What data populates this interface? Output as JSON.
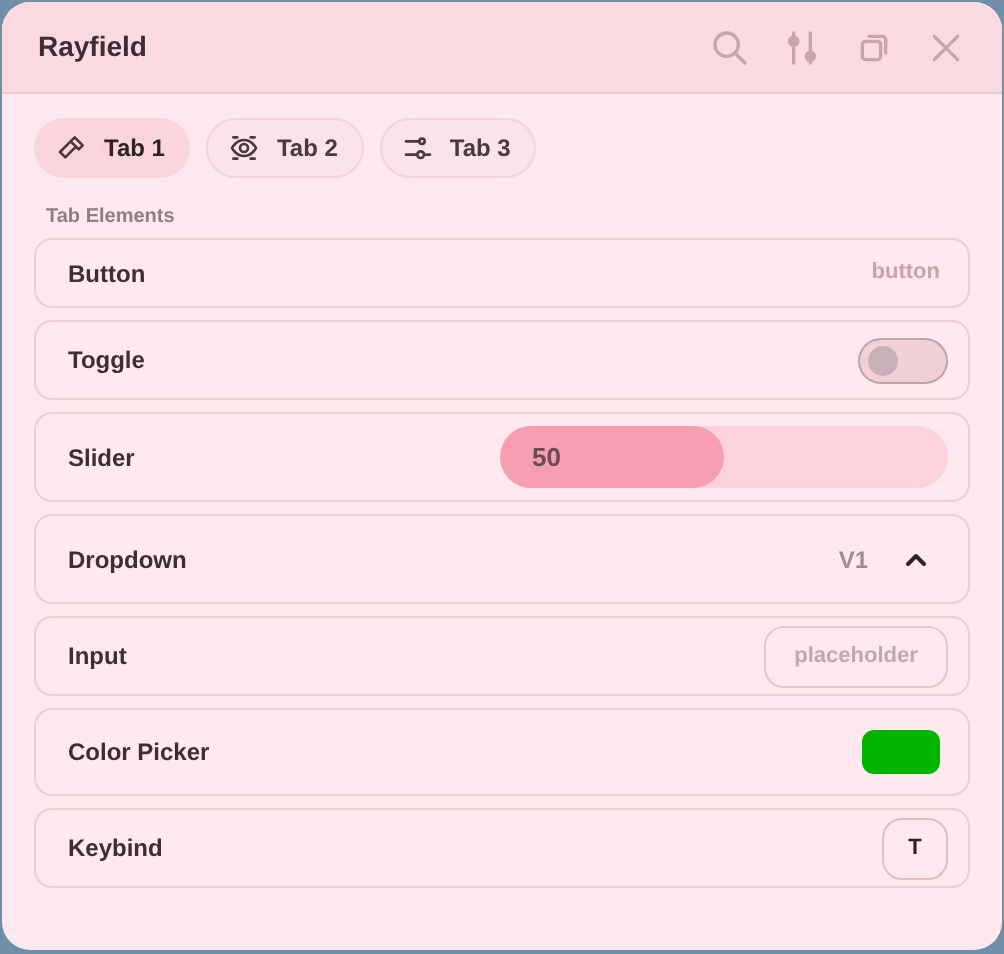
{
  "window": {
    "title": "Rayfield"
  },
  "tabs": [
    {
      "label": "Tab 1",
      "selected": true
    },
    {
      "label": "Tab 2",
      "selected": false
    },
    {
      "label": "Tab 3",
      "selected": false
    }
  ],
  "section": "Tab Elements",
  "elements": [
    {
      "kind": "button",
      "label": "Button",
      "hint": "button"
    },
    {
      "kind": "toggle",
      "label": "Toggle",
      "on": false
    },
    {
      "kind": "slider",
      "label": "Slider",
      "level": 0.5,
      "reading": "50"
    },
    {
      "kind": "dropdown",
      "label": "Dropdown",
      "value": "V1",
      "expanded": true
    },
    {
      "kind": "input",
      "label": "Input",
      "placeholder": "placeholder"
    },
    {
      "kind": "color",
      "label": "Color Picker",
      "color": "#00b400"
    },
    {
      "kind": "keybind",
      "label": "Keybind",
      "key": "T"
    }
  ]
}
